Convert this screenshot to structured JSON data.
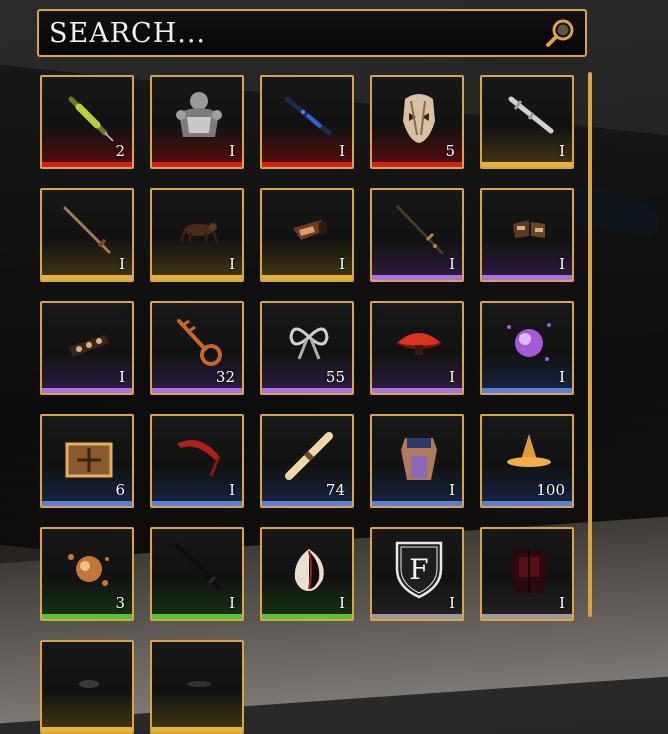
{
  "search": {
    "placeholder": "SEARCH..."
  },
  "colors": {
    "frame": "#d9a441",
    "rarity_red": "#d1231b",
    "rarity_gold": "#e4b43a",
    "rarity_purple": "#a873e0",
    "rarity_blue": "#5b7fd6",
    "rarity_green": "#5ac140",
    "rarity_gray": "#9a9a9a"
  },
  "inventory": {
    "items": [
      {
        "icon": "syringe-icon",
        "count": "2",
        "rarity": "red"
      },
      {
        "icon": "armor-chest-icon",
        "count": "I",
        "rarity": "red"
      },
      {
        "icon": "blue-rifle-icon",
        "count": "I",
        "rarity": "red"
      },
      {
        "icon": "skull-mask-icon",
        "count": "5",
        "rarity": "red"
      },
      {
        "icon": "silver-blade-icon",
        "count": "I",
        "rarity": "gold"
      },
      {
        "icon": "staff-icon",
        "count": "I",
        "rarity": "gold"
      },
      {
        "icon": "beast-figure-icon",
        "count": "I",
        "rarity": "gold"
      },
      {
        "icon": "gauntlet-icon",
        "count": "I",
        "rarity": "gold"
      },
      {
        "icon": "spear-icon",
        "count": "I",
        "rarity": "purple"
      },
      {
        "icon": "boots-icon",
        "count": "I",
        "rarity": "purple"
      },
      {
        "icon": "bracer-icon",
        "count": "I",
        "rarity": "purple"
      },
      {
        "icon": "key-icon",
        "count": "32",
        "rarity": "purple"
      },
      {
        "icon": "ribbon-bow-icon",
        "count": "55",
        "rarity": "purple"
      },
      {
        "icon": "red-mushroom-icon",
        "count": "I",
        "rarity": "purple"
      },
      {
        "icon": "purple-orb-icon",
        "count": "I",
        "rarity": "blue"
      },
      {
        "icon": "treasure-chest-icon",
        "count": "6",
        "rarity": "blue"
      },
      {
        "icon": "red-bow-icon",
        "count": "I",
        "rarity": "blue"
      },
      {
        "icon": "scroll-icon",
        "count": "74",
        "rarity": "blue"
      },
      {
        "icon": "robe-icon",
        "count": "I",
        "rarity": "blue"
      },
      {
        "icon": "witch-hat-icon",
        "count": "100",
        "rarity": "blue"
      },
      {
        "icon": "amber-orb-icon",
        "count": "3",
        "rarity": "green"
      },
      {
        "icon": "black-sword-icon",
        "count": "I",
        "rarity": "green"
      },
      {
        "icon": "egg-shell-icon",
        "count": "I",
        "rarity": "green"
      },
      {
        "icon": "f-shield-emblem-icon",
        "count": "I",
        "rarity": "gray",
        "emblem_letter": "F"
      },
      {
        "icon": "dark-tunic-icon",
        "count": "I",
        "rarity": "gray"
      },
      {
        "icon": "item-icon",
        "count": "",
        "rarity": "gold"
      },
      {
        "icon": "item-icon",
        "count": "",
        "rarity": "gold"
      }
    ]
  }
}
